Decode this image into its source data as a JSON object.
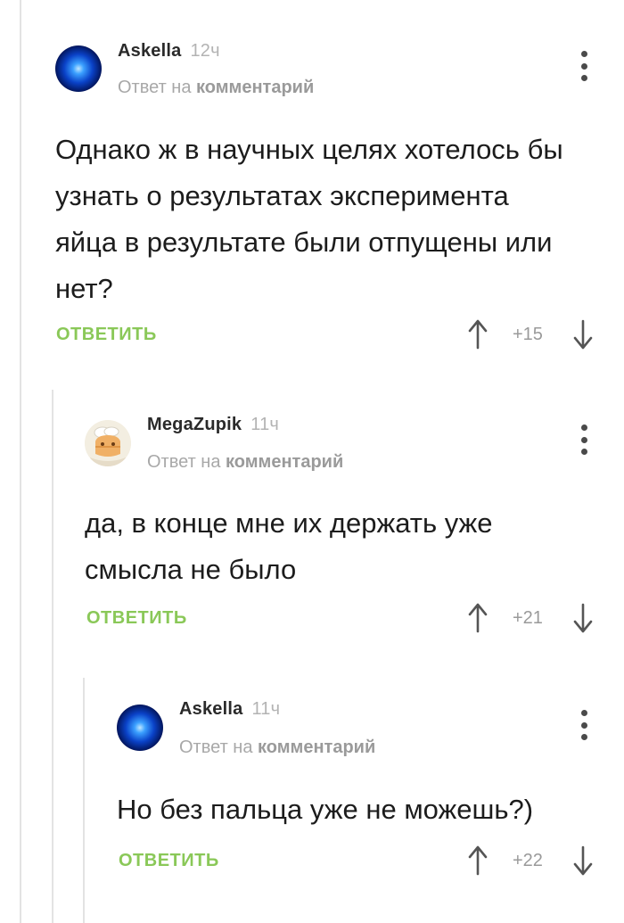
{
  "comments": [
    {
      "author": "Askella",
      "time": "12ч",
      "reply_prefix": "Ответ на",
      "reply_target": "комментарий",
      "text": "Однако ж в научных целях хотелось бы узнать о результатах эксперимента яйца в результате были отпущены или нет?",
      "reply_label": "ОТВЕТИТЬ",
      "score": "+15",
      "avatar_icon": "blue-orb-avatar"
    },
    {
      "author": "MegaZupik",
      "time": "11ч",
      "reply_prefix": "Ответ на",
      "reply_target": "комментарий",
      "text": "да, в конце мне их держать уже смысла не было",
      "reply_label": "ОТВЕТИТЬ",
      "score": "+21",
      "avatar_icon": "cartoon-chef-avatar"
    },
    {
      "author": "Askella",
      "time": "11ч",
      "reply_prefix": "Ответ на",
      "reply_target": "комментарий",
      "text": "Но без пальца уже не можешь?)",
      "reply_label": "ОТВЕТИТЬ",
      "score": "+22",
      "avatar_icon": "blue-orb-avatar"
    }
  ],
  "colors": {
    "reply_green": "#8ac858",
    "thread_line": "#e3e3e3",
    "muted_text": "#a8a8a8"
  }
}
